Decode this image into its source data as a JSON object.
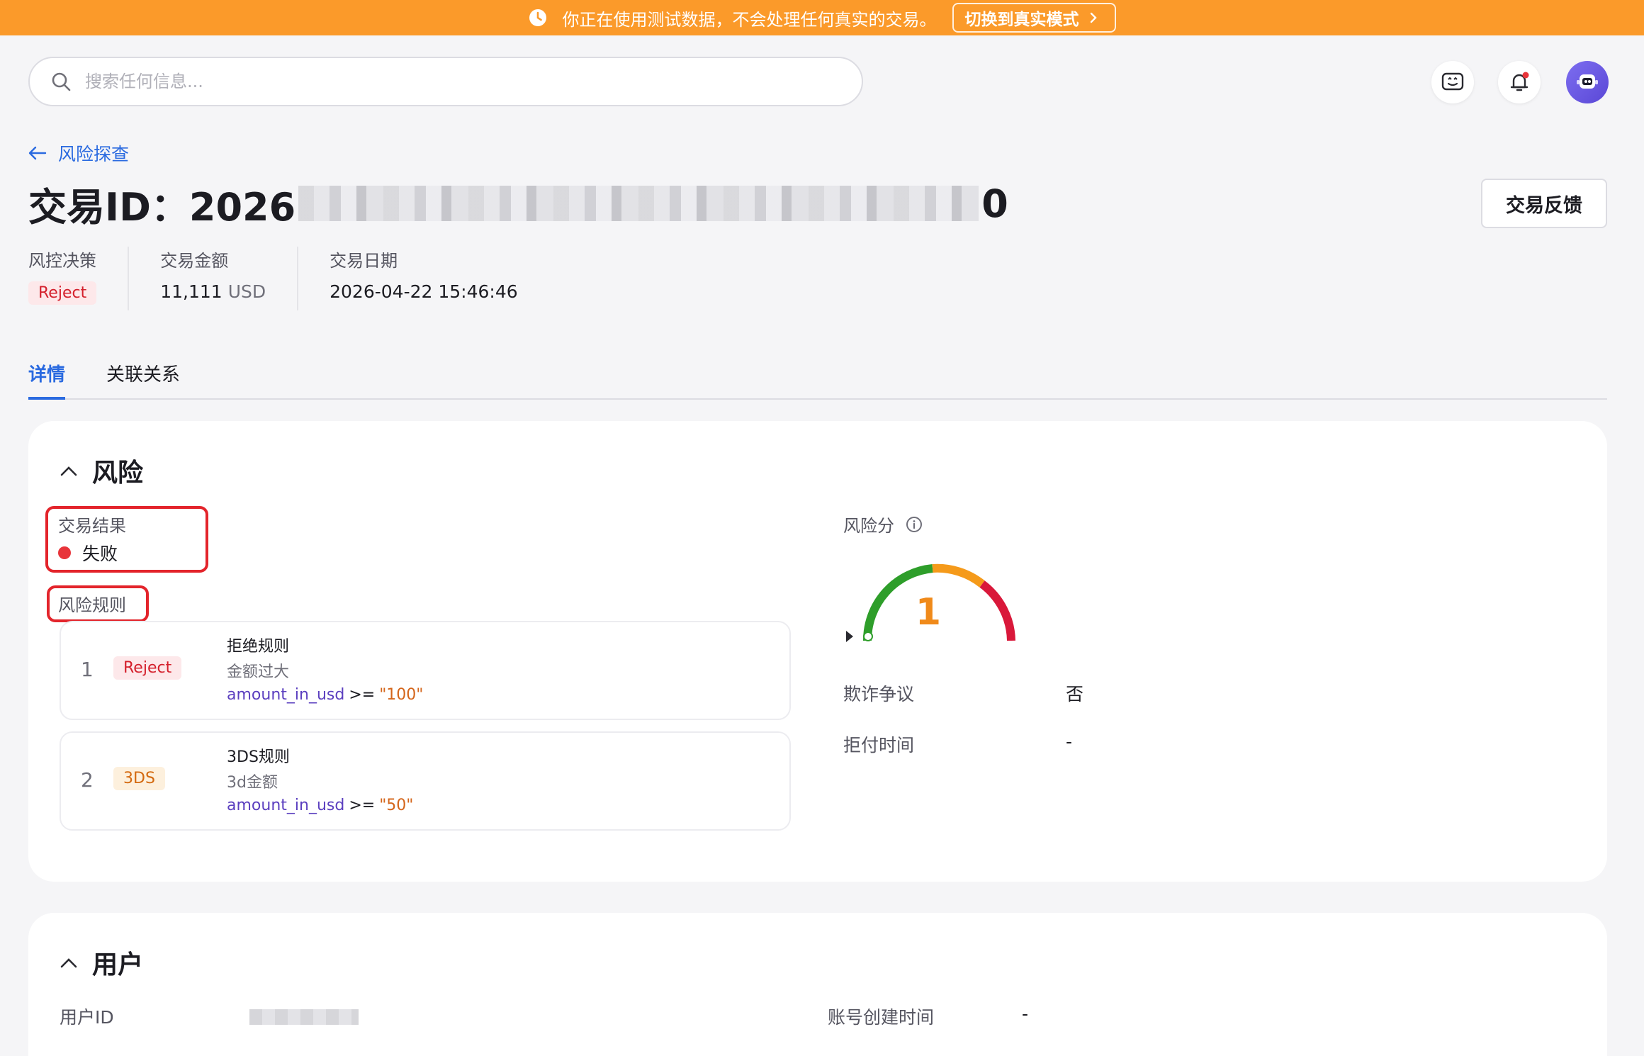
{
  "banner": {
    "message": "你正在使用测试数据，不会处理任何真实的交易。",
    "switch_label": "切换到真实模式"
  },
  "header": {
    "search_placeholder": "搜索任何信息..."
  },
  "breadcrumb": {
    "label": "风险探查"
  },
  "transaction": {
    "title_prefix": "交易ID：2026",
    "title_suffix": "0",
    "feedback_button": "交易反馈"
  },
  "summary": {
    "decision_label": "风控决策",
    "decision_value": "Reject",
    "amount_label": "交易金额",
    "amount_value": "11,111",
    "amount_unit": "USD",
    "date_label": "交易日期",
    "date_value": "2026-04-22 15:46:46"
  },
  "tabs": [
    {
      "label": "详情",
      "active": true
    },
    {
      "label": "关联关系",
      "active": false
    }
  ],
  "risk": {
    "section_title": "风险",
    "result_label": "交易结果",
    "result_value": "失败",
    "rules_label": "风险规则",
    "rules": [
      {
        "index": "1",
        "tag": "Reject",
        "name": "拒绝规则",
        "desc": "金额过大",
        "field": "amount_in_usd",
        "op": ">=",
        "value": "\"100\""
      },
      {
        "index": "2",
        "tag": "3DS",
        "name": "3DS规则",
        "desc": "3d金额",
        "field": "amount_in_usd",
        "op": ">=",
        "value": "\"50\""
      }
    ],
    "score_label": "风险分",
    "score_value": "1",
    "fraud_dispute_label": "欺诈争议",
    "fraud_dispute_value": "否",
    "chargeback_label": "拒付时间",
    "chargeback_value": "-"
  },
  "user": {
    "section_title": "用户",
    "user_id_label": "用户ID",
    "created_label": "账号创建时间",
    "created_value": "-"
  },
  "colors": {
    "banner": "#fb9a2a",
    "accent": "#2a6ae0",
    "reject": "#d4202c",
    "threeds": "#d46a10",
    "gauge_green": "#2e9e2a",
    "gauge_orange": "#f59a1a",
    "gauge_red": "#d9183a"
  }
}
